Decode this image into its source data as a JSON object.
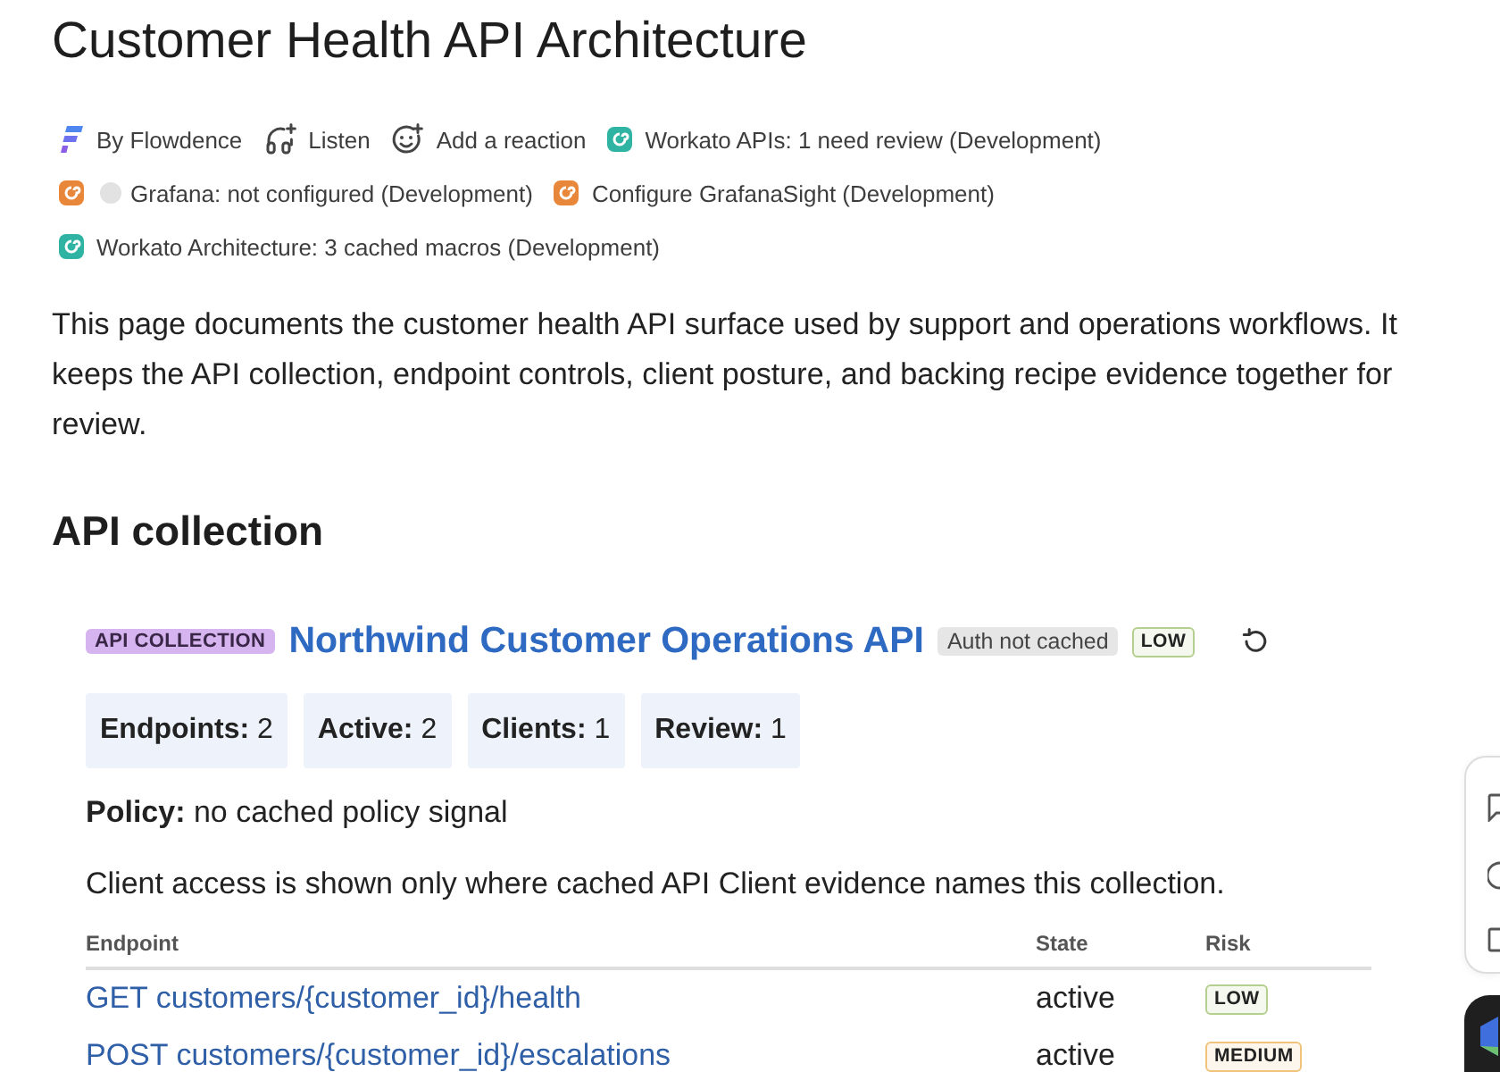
{
  "title": "Customer Health API Architecture",
  "meta_rows": [
    [
      {
        "kind": "author",
        "label": "By Flowdence"
      },
      {
        "kind": "listen",
        "label": "Listen"
      },
      {
        "kind": "reaction",
        "label": "Add a reaction"
      },
      {
        "kind": "workato",
        "label": "Workato APIs: 1 need review (Development)"
      }
    ],
    [
      {
        "kind": "grafana",
        "label": "Grafana: not configured (Development)",
        "color": "#e2e2e2"
      },
      {
        "kind": "grafana",
        "label": "Configure GrafanaSight (Development)"
      }
    ],
    [
      {
        "kind": "workato",
        "label": "Workato Architecture: 3 cached macros (Development)"
      }
    ]
  ],
  "intro": "This page documents the customer health API surface used by support and operations workflows. It keeps the API collection, endpoint controls, client posture, and backing recipe evidence together for review.",
  "section_heading": "API collection",
  "collection": {
    "badge": "API COLLECTION",
    "name": "Northwind Customer Operations API",
    "auth": "Auth not cached",
    "risk": {
      "label": "LOW",
      "color": "#b5d08e"
    },
    "stats": [
      {
        "label": "Endpoints:",
        "value": "2"
      },
      {
        "label": "Active:",
        "value": "2"
      },
      {
        "label": "Clients:",
        "value": "1"
      },
      {
        "label": "Review:",
        "value": "1"
      }
    ],
    "policy": {
      "label": "Policy:",
      "value": "no cached policy signal"
    },
    "note": "Client access is shown only where cached API Client evidence names this collection.",
    "table": {
      "columns": [
        "Endpoint",
        "State",
        "Risk"
      ],
      "rows": [
        {
          "endpoint": "GET customers/{customer_id}/health",
          "state": "active",
          "risk": {
            "label": "LOW",
            "color": "#b5d08e"
          }
        },
        {
          "endpoint": "POST customers/{customer_id}/escalations",
          "state": "active",
          "risk": {
            "label": "MEDIUM",
            "color": "#f0c27a"
          }
        }
      ]
    }
  }
}
